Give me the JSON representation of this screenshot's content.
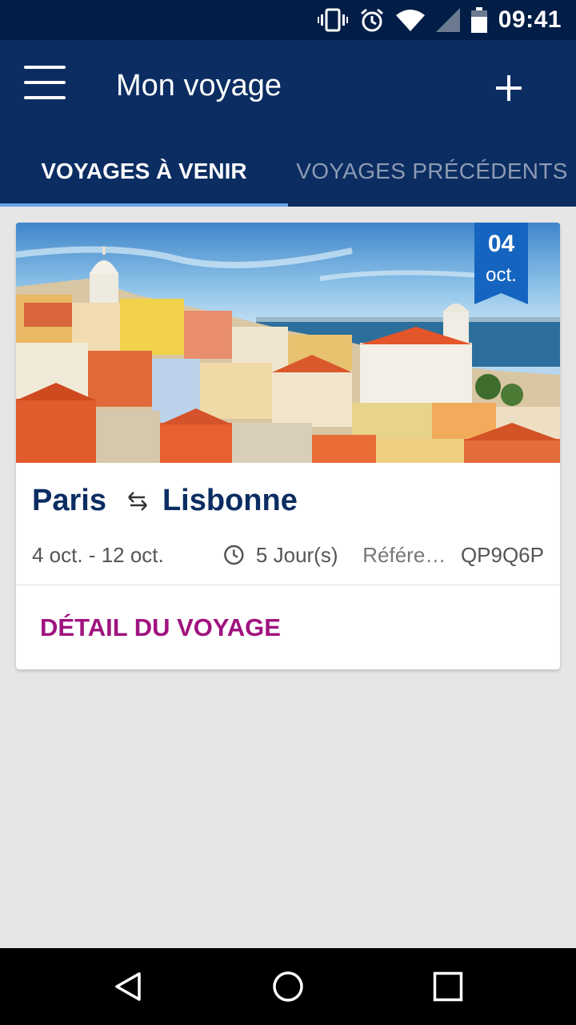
{
  "status_bar": {
    "time": "09:41",
    "icons": [
      "vibrate-icon",
      "alarm-icon",
      "wifi-icon",
      "signal-icon",
      "battery-icon"
    ]
  },
  "app_bar": {
    "title": "Mon voyage",
    "menu_icon": "menu-icon",
    "add_icon": "plus-icon"
  },
  "tabs": [
    {
      "label": "VOYAGES À VENIR",
      "active": true
    },
    {
      "label": "VOYAGES PRÉCÉDENTS",
      "active": false
    }
  ],
  "trip": {
    "badge_day": "04",
    "badge_month": "oct.",
    "origin": "Paris",
    "destination": "Lisbonne",
    "dates": "4 oct. - 12 oct.",
    "duration": "5 Jour(s)",
    "reference_label": "Référen...",
    "reference_code": "QP9Q6P",
    "detail_label": "DÉTAIL DU VOYAGE"
  },
  "nav_bar": {
    "icons": [
      "back-icon",
      "home-icon",
      "recents-icon"
    ]
  },
  "colors": {
    "primary": "#0b2d62",
    "status_bar": "#021e47",
    "accent": "#a0137f",
    "tab_indicator": "#6aa2e8",
    "badge": "#1565c0"
  }
}
